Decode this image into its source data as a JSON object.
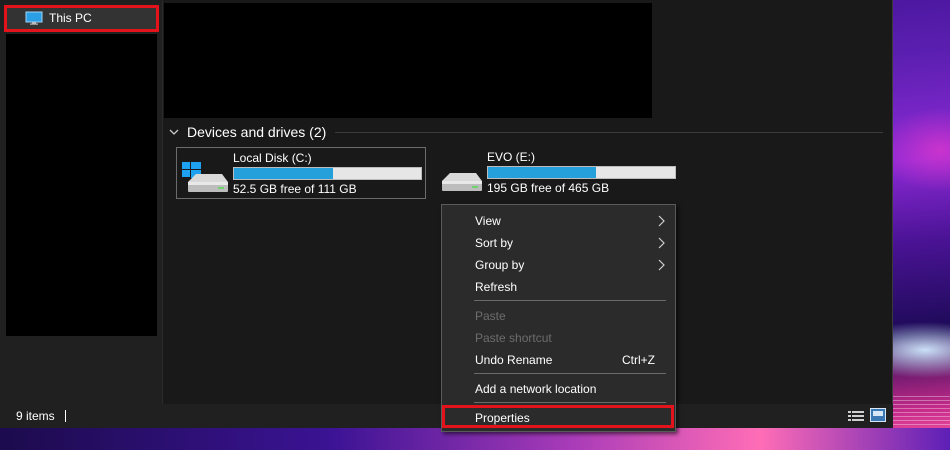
{
  "nav": {
    "this_pc_label": "This PC"
  },
  "group": {
    "header": "Devices and drives (2)"
  },
  "drives": [
    {
      "name": "Local Disk (C:)",
      "free_text": "52.5 GB free of 111 GB",
      "used_fraction": 0.527,
      "icon": "windows-drive-icon"
    },
    {
      "name": "EVO (E:)",
      "free_text": "195 GB free of 465 GB",
      "used_fraction": 0.58,
      "icon": "drive-icon"
    }
  ],
  "context_menu": {
    "items": [
      {
        "label": "View",
        "submenu": true,
        "enabled": true
      },
      {
        "label": "Sort by",
        "submenu": true,
        "enabled": true
      },
      {
        "label": "Group by",
        "submenu": true,
        "enabled": true
      },
      {
        "label": "Refresh",
        "enabled": true
      },
      {
        "label": "Paste",
        "enabled": false
      },
      {
        "label": "Paste shortcut",
        "enabled": false
      },
      {
        "label": "Undo Rename",
        "shortcut": "Ctrl+Z",
        "enabled": true
      },
      {
        "label": "Add a network location",
        "enabled": true
      },
      {
        "label": "Properties",
        "enabled": true
      }
    ]
  },
  "status_bar": {
    "items_count": "9 items"
  },
  "colors": {
    "highlight": "#e3121b",
    "bar_fill": "#26a0da"
  }
}
